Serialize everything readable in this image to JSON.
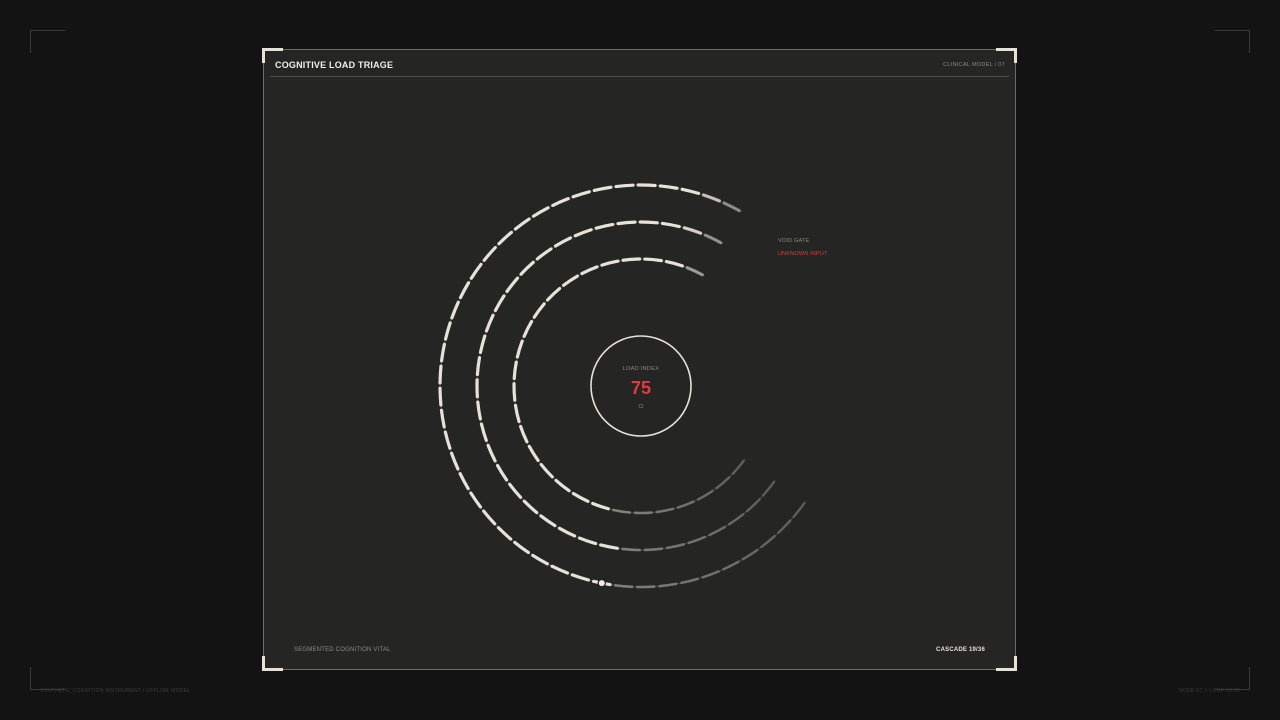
{
  "panel": {
    "title": "COGNITIVE LOAD TRIAGE",
    "model": "CLINICAL MODEL / 07",
    "footer_left": "SEGMENTED COGNITION VITAL",
    "footer_right": "CASCADE 19/36"
  },
  "page_footer": {
    "left": "SYNTHETIC COGNITION INSTRUMENT / OFFLINE MODEL",
    "right": "NODE 07 // LOOP 19.36"
  },
  "gauge": {
    "label": "LOAD INDEX",
    "value": "75",
    "unit": "CI",
    "rings": 3,
    "active_value": 75,
    "annotation": {
      "title": "VOID GATE",
      "status": "UNKNOWN INPUT"
    }
  },
  "colors": {
    "background": "#121312",
    "panel": "#252523",
    "ink": "#e6e2d6",
    "muted": "#7a7a72",
    "alert": "#e5383b"
  }
}
